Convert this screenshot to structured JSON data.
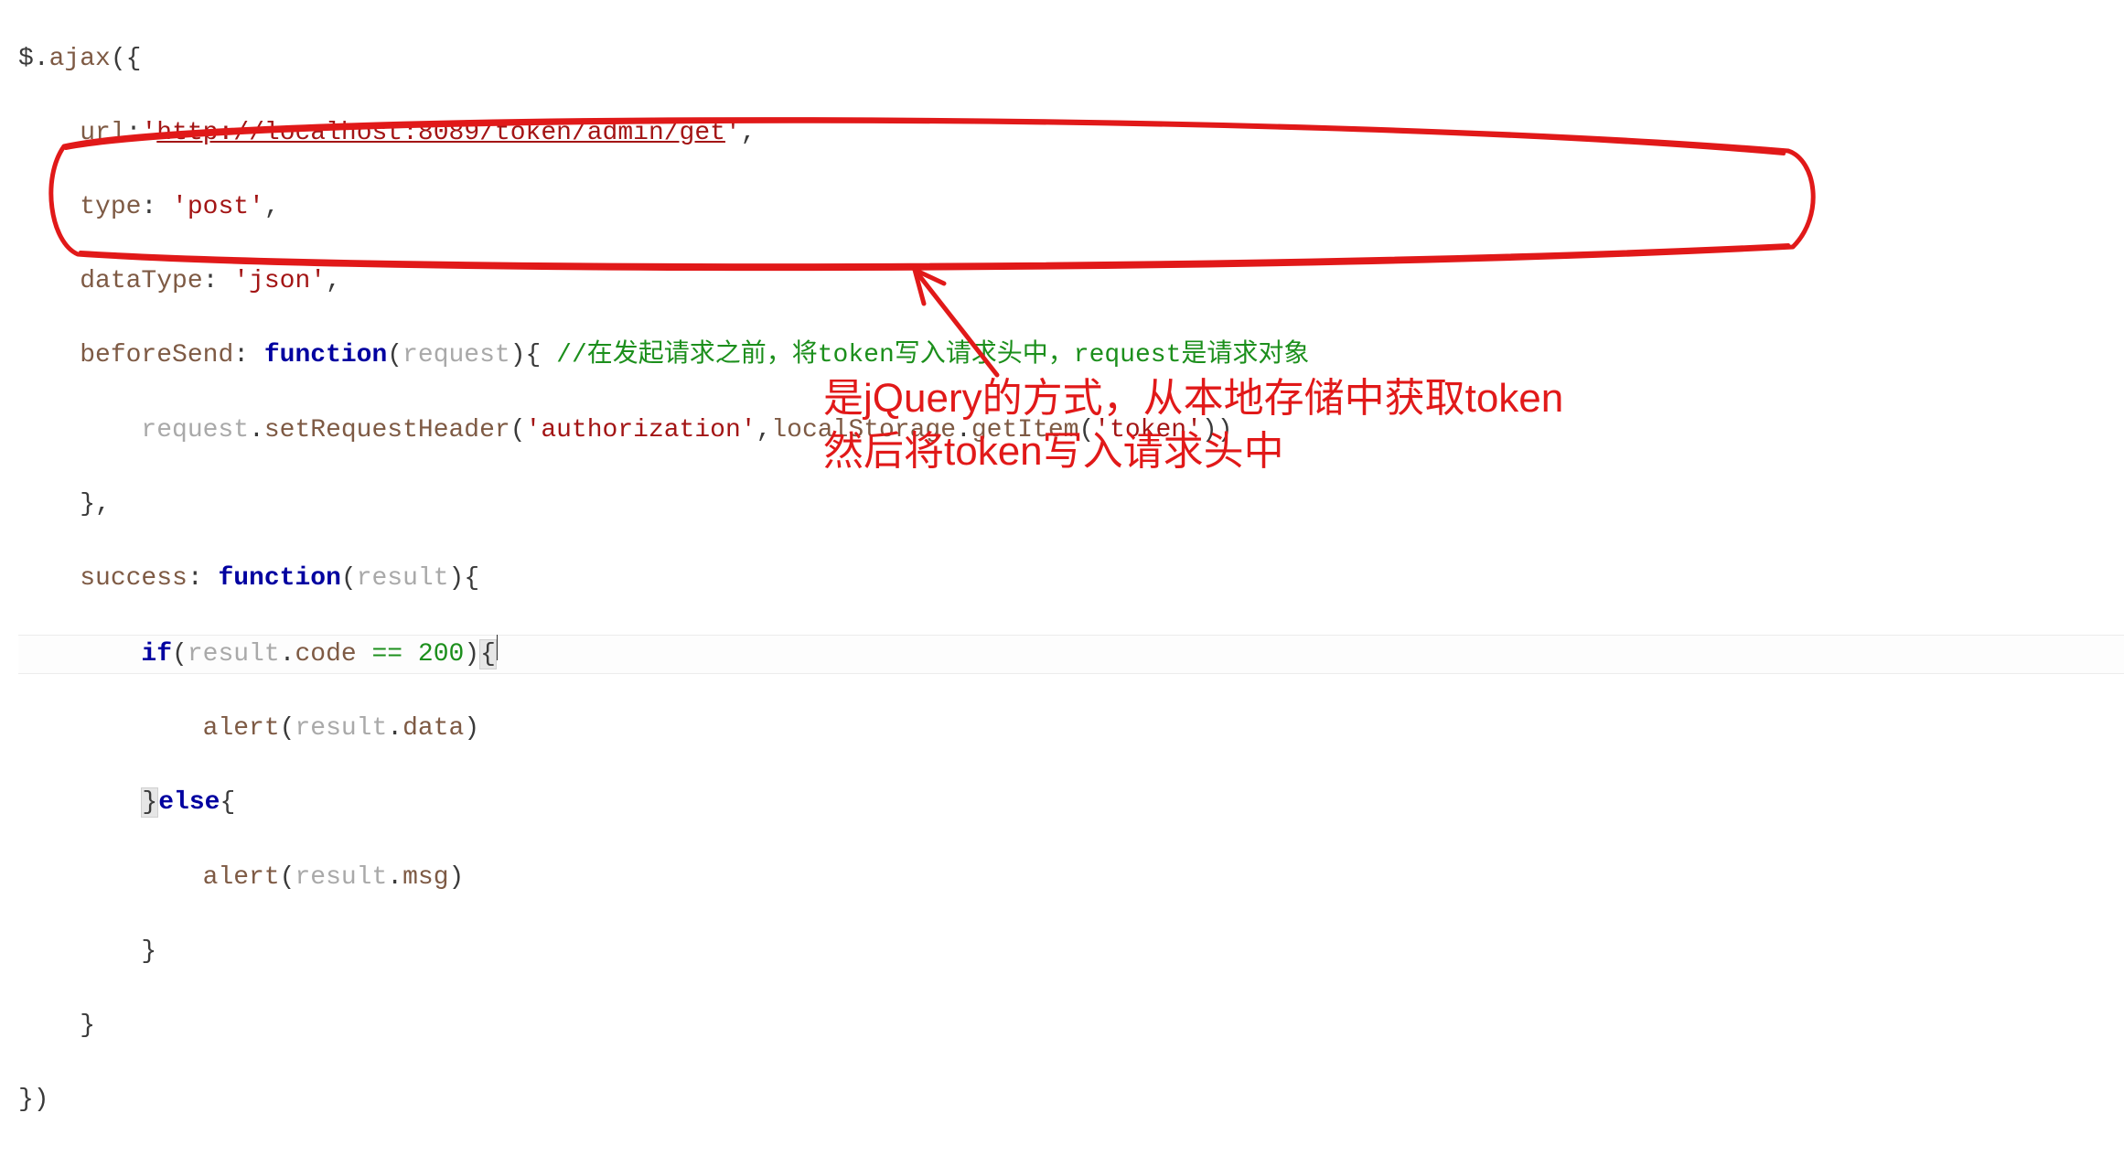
{
  "code": {
    "l1a": "$",
    "l1b": ".",
    "l1c": "ajax",
    "l1d": "({",
    "l2a": "url",
    "l2b": ":",
    "l2c": "'",
    "l2d": "http://localhost:8089/token/admin/get",
    "l2e": "'",
    "l2f": ",",
    "l3a": "type",
    "l3b": ": ",
    "l3c": "'post'",
    "l3d": ",",
    "l4a": "dataType",
    "l4b": ": ",
    "l4c": "'json'",
    "l4d": ",",
    "l5a": "beforeSend",
    "l5b": ": ",
    "l5c": "function",
    "l5d": "(",
    "l5e": "request",
    "l5f": "){ ",
    "l5g": "//在发起请求之前，将token写入请求头中，request是请求对象",
    "l6a": "request",
    "l6b": ".",
    "l6c": "setRequestHeader",
    "l6d": "(",
    "l6e": "'authorization'",
    "l6f": ",",
    "l6g": "localStorage",
    "l6h": ".",
    "l6i": "getItem",
    "l6j": "(",
    "l6k": "'token'",
    "l6l": "))",
    "l7a": "},",
    "l8a": "success",
    "l8b": ": ",
    "l8c": "function",
    "l8d": "(",
    "l8e": "result",
    "l8f": "){",
    "l9a": "if",
    "l9b": "(",
    "l9c": "result",
    "l9d": ".",
    "l9e": "code",
    "l9f": " == ",
    "l9g": "200",
    "l9h": ")",
    "l9i": "{",
    "l10a": "alert",
    "l10b": "(",
    "l10c": "result",
    "l10d": ".",
    "l10e": "data",
    "l10f": ")",
    "l11a": "}",
    "l11b": "else",
    "l11c": "{",
    "l12a": "alert",
    "l12b": "(",
    "l12c": "result",
    "l12d": ".",
    "l12e": "msg",
    "l12f": ")",
    "l13a": "}",
    "l14a": "}",
    "l15a": "})"
  },
  "annotation": {
    "line1": "是jQuery的方式，从本地存储中获取token",
    "line2": "然后将token写入请求头中"
  },
  "colors": {
    "annotation_stroke": "#e11919"
  }
}
